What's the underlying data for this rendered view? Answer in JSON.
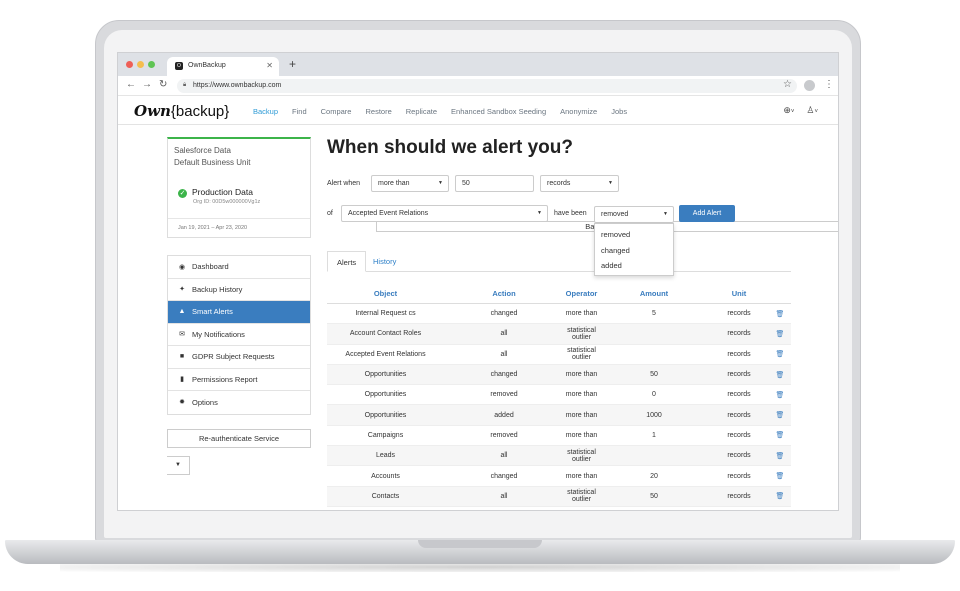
{
  "browser": {
    "tab_title": "OwnBackup",
    "url": "https://www.ownbackup.com"
  },
  "nav": {
    "logo_own": "Own",
    "logo_backup": "{backup}",
    "links": [
      {
        "label": "Backup",
        "active": true
      },
      {
        "label": "Find"
      },
      {
        "label": "Compare"
      },
      {
        "label": "Restore"
      },
      {
        "label": "Replicate"
      },
      {
        "label": "Enhanced Sandbox Seeding"
      },
      {
        "label": "Anonymize"
      },
      {
        "label": "Jobs"
      }
    ],
    "globe_icon": "globe-icon",
    "user_icon": "user-icon"
  },
  "account": {
    "line1": "Salesforce Data",
    "line2": "Default Business Unit",
    "env_name": "Production Data",
    "org_id": "Org ID: 00D5w000000Vg1z",
    "date_range": "Jan 19, 2021 – Apr 23, 2020"
  },
  "menu": [
    {
      "label": "Dashboard",
      "icon": "dashboard-icon",
      "glyph": "◉"
    },
    {
      "label": "Backup History",
      "icon": "history-icon",
      "glyph": "✦"
    },
    {
      "label": "Smart Alerts",
      "icon": "bell-icon",
      "glyph": "▲",
      "active": true
    },
    {
      "label": "My Notifications",
      "icon": "envelope-icon",
      "glyph": "✉"
    },
    {
      "label": "GDPR Subject Requests",
      "icon": "lock-icon",
      "glyph": "■"
    },
    {
      "label": "Permissions Report",
      "icon": "file-icon",
      "glyph": "▮"
    },
    {
      "label": "Options",
      "icon": "gear-icon",
      "glyph": "✹"
    }
  ],
  "buttons": {
    "reauth": "Re-authenticate Service",
    "backup_now": "Back Up Now",
    "add_alert": "Add Alert"
  },
  "alert_form": {
    "title": "When should we alert you?",
    "alert_when_label": "Alert when",
    "operator_value": "more than",
    "amount_value": "50",
    "unit_value": "records",
    "of_label": "of",
    "object_value": "Accepted Event Relations",
    "have_been_label": "have been",
    "action_value": "removed",
    "action_options": [
      "removed",
      "changed",
      "added"
    ]
  },
  "tabs": [
    "Alerts",
    "History"
  ],
  "table": {
    "headers": [
      "Object",
      "Action",
      "Operator",
      "Amount",
      "Unit"
    ],
    "rows": [
      [
        "Internal Request cs",
        "changed",
        "more than",
        "5",
        "records"
      ],
      [
        "Account Contact Roles",
        "all",
        "statistical outlier",
        "",
        "records"
      ],
      [
        "Accepted Event Relations",
        "all",
        "statistical outlier",
        "",
        "records"
      ],
      [
        "Opportunities",
        "changed",
        "more than",
        "50",
        "records"
      ],
      [
        "Opportunities",
        "removed",
        "more than",
        "0",
        "records"
      ],
      [
        "Opportunities",
        "added",
        "more than",
        "1000",
        "records"
      ],
      [
        "Campaigns",
        "removed",
        "more than",
        "1",
        "records"
      ],
      [
        "Leads",
        "all",
        "statistical outlier",
        "",
        "records"
      ],
      [
        "Accounts",
        "changed",
        "more than",
        "20",
        "records"
      ],
      [
        "Contacts",
        "all",
        "statistical outlier",
        "50",
        "records"
      ]
    ]
  }
}
